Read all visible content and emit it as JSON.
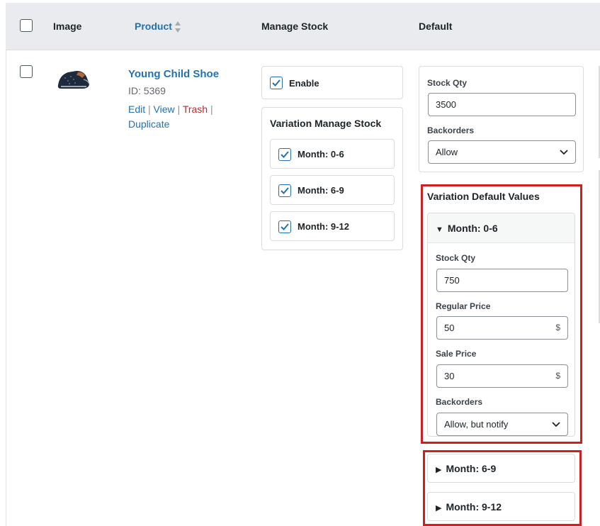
{
  "columns": {
    "image": "Image",
    "product": "Product",
    "manage_stock": "Manage Stock",
    "default": "Default"
  },
  "product": {
    "title": "Young Child Shoe",
    "id_text": "ID: 5369",
    "actions": {
      "edit": "Edit",
      "view": "View",
      "trash": "Trash",
      "duplicate": "Duplicate",
      "separator": "|"
    }
  },
  "manage_stock": {
    "enable_label": "Enable",
    "variation_title": "Variation Manage Stock",
    "variations": [
      "Month: 0-6",
      "Month: 6-9",
      "Month: 9-12"
    ]
  },
  "defaults": {
    "stock_qty_label": "Stock Qty",
    "stock_qty_value": "3500",
    "backorders_label": "Backorders",
    "backorders_value": "Allow",
    "variation_defaults_title": "Variation Default Values",
    "expanded": {
      "header": "Month: 0-6",
      "stock_qty_label": "Stock Qty",
      "stock_qty_value": "750",
      "regular_price_label": "Regular Price",
      "regular_price_value": "50",
      "sale_price_label": "Sale Price",
      "sale_price_value": "30",
      "currency": "$",
      "backorders_label": "Backorders",
      "backorders_value": "Allow, but notify"
    },
    "collapsed": [
      "Month: 6-9",
      "Month: 9-12"
    ]
  },
  "colors": {
    "accent": "#2271b1",
    "highlight": "#d21e1e",
    "trash": "#b32d2e"
  }
}
